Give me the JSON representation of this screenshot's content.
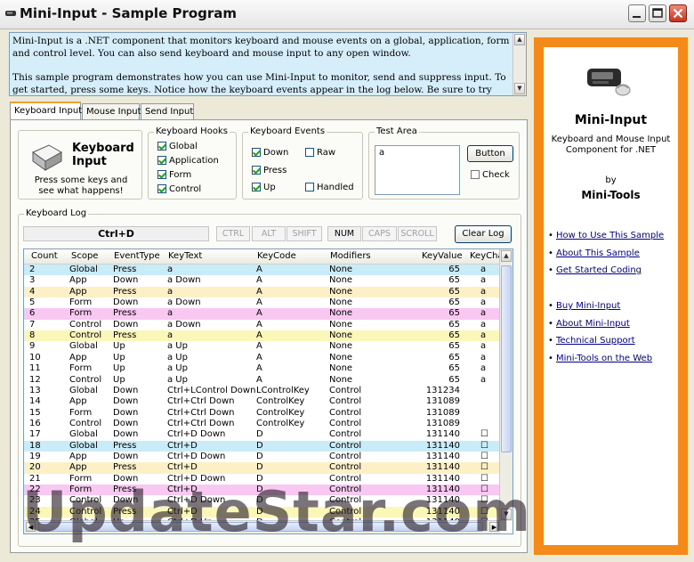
{
  "window": {
    "title": "Mini-Input - Sample Program"
  },
  "description": {
    "paragraph1": "Mini-Input is a .NET component that monitors keyboard and mouse events on a global, application, form and control level.  You can also send keyboard and mouse input to any open window.",
    "paragraph2": "This sample program demonstrates how you can use Mini-Input to monitor, send and suppress input.  To get started, press some keys.  Notice how the keyboard events appear in the log below.  Be sure to try different key"
  },
  "tabs": [
    {
      "label": "Keyboard Input",
      "active": true
    },
    {
      "label": "Mouse Input",
      "active": false
    },
    {
      "label": "Send Input",
      "active": false
    }
  ],
  "keyboard_card": {
    "title_line1": "Keyboard",
    "title_line2": "Input",
    "subtitle_line1": "Press some keys and",
    "subtitle_line2": "see what happens!",
    "icon": "keyboard-key-icon"
  },
  "hooks": {
    "legend": "Keyboard Hooks",
    "items": [
      {
        "label": "Global",
        "checked": true
      },
      {
        "label": "Application",
        "checked": true
      },
      {
        "label": "Form",
        "checked": true
      },
      {
        "label": "Control",
        "checked": true
      }
    ]
  },
  "events": {
    "legend": "Keyboard Events",
    "items": [
      {
        "label": "Down",
        "checked": true
      },
      {
        "label": "Raw",
        "checked": false
      },
      {
        "label": "Press",
        "checked": true
      },
      {
        "label": "Up",
        "checked": true
      },
      {
        "label": "Handled",
        "checked": false
      }
    ]
  },
  "test_area": {
    "legend": "Test Area",
    "text_value": "a",
    "button_label": "Button",
    "check_label": "Check",
    "check_checked": false
  },
  "log": {
    "legend": "Keyboard Log",
    "current_key": "Ctrl+D",
    "indicators": [
      {
        "label": "CTRL",
        "on": false
      },
      {
        "label": "ALT",
        "on": false
      },
      {
        "label": "SHIFT",
        "on": false
      },
      {
        "label": "NUM",
        "on": true
      },
      {
        "label": "CAPS",
        "on": false
      },
      {
        "label": "SCROLL",
        "on": false
      }
    ],
    "clear_label": "Clear Log",
    "columns": [
      "Count",
      "Scope",
      "EventType",
      "KeyText",
      "KeyCode",
      "Modifiers",
      "KeyValue",
      "KeyCha"
    ],
    "rows": [
      [
        "2",
        "Global",
        "Press",
        "a",
        "A",
        "None",
        "65",
        "a"
      ],
      [
        "3",
        "App",
        "Down",
        "a Down",
        "A",
        "None",
        "65",
        "a"
      ],
      [
        "4",
        "App",
        "Press",
        "a",
        "A",
        "None",
        "65",
        "a"
      ],
      [
        "5",
        "Form",
        "Down",
        "a Down",
        "A",
        "None",
        "65",
        "a"
      ],
      [
        "6",
        "Form",
        "Press",
        "a",
        "A",
        "None",
        "65",
        "a"
      ],
      [
        "7",
        "Control",
        "Down",
        "a Down",
        "A",
        "None",
        "65",
        "a"
      ],
      [
        "8",
        "Control",
        "Press",
        "a",
        "A",
        "None",
        "65",
        "a"
      ],
      [
        "9",
        "Global",
        "Up",
        "a Up",
        "A",
        "None",
        "65",
        "a"
      ],
      [
        "10",
        "App",
        "Up",
        "a Up",
        "A",
        "None",
        "65",
        "a"
      ],
      [
        "11",
        "Form",
        "Up",
        "a Up",
        "A",
        "None",
        "65",
        "a"
      ],
      [
        "12",
        "Control",
        "Up",
        "a Up",
        "A",
        "None",
        "65",
        "a"
      ],
      [
        "13",
        "Global",
        "Down",
        "Ctrl+LControl Down",
        "LControlKey",
        "Control",
        "131234",
        ""
      ],
      [
        "14",
        "App",
        "Down",
        "Ctrl+Ctrl Down",
        "ControlKey",
        "Control",
        "131089",
        ""
      ],
      [
        "15",
        "Form",
        "Down",
        "Ctrl+Ctrl Down",
        "ControlKey",
        "Control",
        "131089",
        ""
      ],
      [
        "16",
        "Control",
        "Down",
        "Ctrl+Ctrl Down",
        "ControlKey",
        "Control",
        "131089",
        ""
      ],
      [
        "17",
        "Global",
        "Down",
        "Ctrl+D Down",
        "D",
        "Control",
        "131140",
        "☐"
      ],
      [
        "18",
        "Global",
        "Press",
        "Ctrl+D",
        "D",
        "Control",
        "131140",
        "☐"
      ],
      [
        "19",
        "App",
        "Down",
        "Ctrl+D Down",
        "D",
        "Control",
        "131140",
        "☐"
      ],
      [
        "20",
        "App",
        "Press",
        "Ctrl+D",
        "D",
        "Control",
        "131140",
        "☐"
      ],
      [
        "21",
        "Form",
        "Down",
        "Ctrl+D Down",
        "D",
        "Control",
        "131140",
        "☐"
      ],
      [
        "22",
        "Form",
        "Press",
        "Ctrl+D",
        "D",
        "Control",
        "131140",
        "☐"
      ],
      [
        "23",
        "Control",
        "Down",
        "Ctrl+D Down",
        "D",
        "Control",
        "131140",
        "☐"
      ],
      [
        "24",
        "Control",
        "Press",
        "Ctrl+D",
        "D",
        "Control",
        "131140",
        "☐"
      ],
      [
        "25",
        "Global",
        "Up",
        "Ctrl+D Up",
        "D",
        "Control",
        "131140",
        "☐"
      ]
    ],
    "scope_colors": {
      "Global": "#c8ecf8",
      "App": "#fdefc6",
      "Form": "#f8c8f2",
      "Control": "#fbf7b8"
    }
  },
  "sidebar": {
    "product_name": "Mini-Input",
    "product_desc_line1": "Keyboard and Mouse Input",
    "product_desc_line2": "Component for .NET",
    "by": "by",
    "company": "Mini-Tools",
    "links_group1": [
      "How to Use This Sample",
      "About This Sample",
      "Get Started Coding"
    ],
    "links_group2": [
      "Buy Mini-Input",
      "About Mini-Input",
      "Technical Support",
      "Mini-Tools on the Web"
    ],
    "accent_color": "#f38a1a"
  },
  "watermark": "UpdateStar.com"
}
